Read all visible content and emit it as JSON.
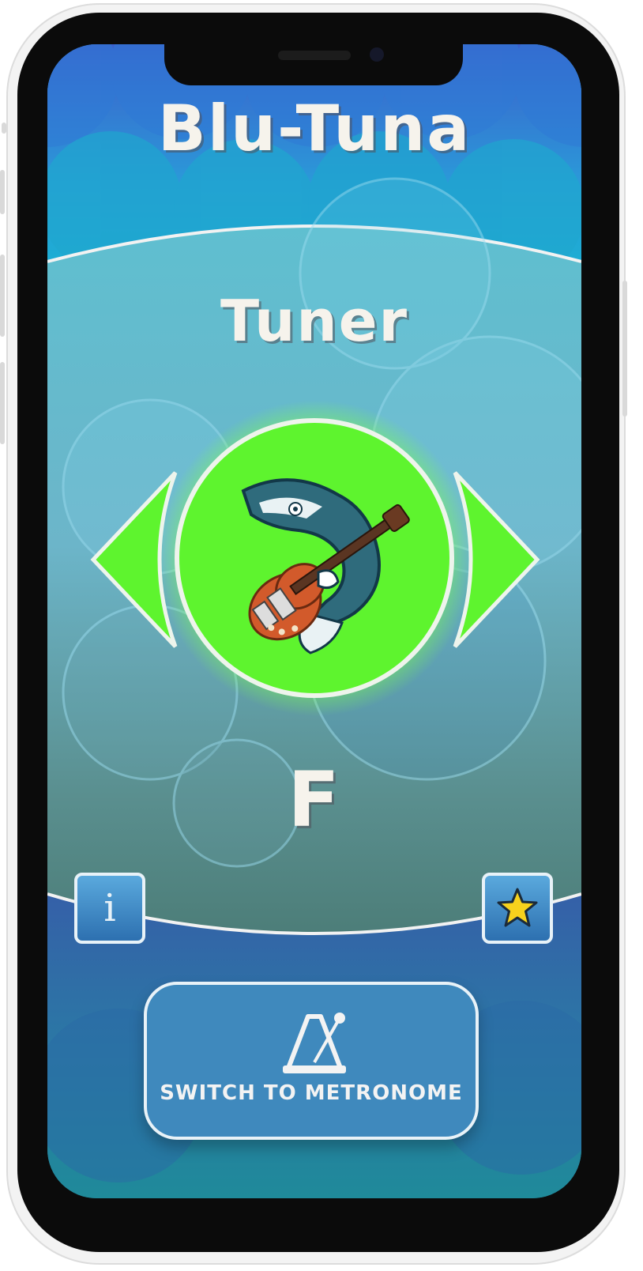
{
  "app": {
    "title": "Blu-Tuna",
    "mode_title": "Tuner",
    "current_note": "F"
  },
  "controls": {
    "prev_arrow_icon": "left-arrow-icon",
    "next_arrow_icon": "right-arrow-icon",
    "info_icon": "info-icon",
    "info_glyph": "i",
    "star_icon": "star-icon",
    "metronome_icon": "metronome-icon",
    "switch_label": "SWITCH TO METRONOME"
  },
  "logo": {
    "icon": "tuna-guitar-logo"
  },
  "colors": {
    "accent_green": "#5ef42e",
    "button_blue": "#3f89bd",
    "text_cream": "#f6f3ec",
    "star_yellow": "#f7d21d"
  }
}
